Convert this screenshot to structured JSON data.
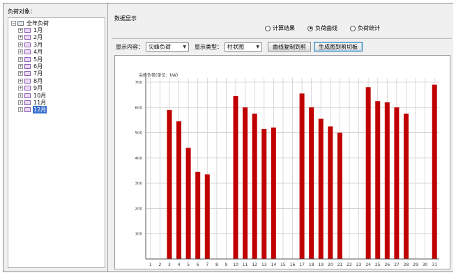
{
  "left_panel": {
    "title": "负荷对象：",
    "tree_root": "全年负荷",
    "tree_items": [
      {
        "label": "1月"
      },
      {
        "label": "2月"
      },
      {
        "label": "3月"
      },
      {
        "label": "4月"
      },
      {
        "label": "5月"
      },
      {
        "label": "6月"
      },
      {
        "label": "7月"
      },
      {
        "label": "8月"
      },
      {
        "label": "9月"
      },
      {
        "label": "10月"
      },
      {
        "label": "11月"
      },
      {
        "label": "12月",
        "selected": true
      }
    ]
  },
  "right_panel": {
    "title": "数据显示",
    "radios": [
      {
        "label": "计算结果",
        "checked": false
      },
      {
        "label": "负荷曲线",
        "checked": true
      },
      {
        "label": "负荷统计",
        "checked": false
      }
    ],
    "toolbar": {
      "content_label": "显示内容：",
      "content_value": "尖峰负荷",
      "type_label": "显示类型：",
      "type_value": "柱状图",
      "copy_button": "曲线复制到剪",
      "gen_button": "生成图到剪切板"
    }
  },
  "colors": {
    "bar": "#c00000",
    "selected": "#3b6fcf"
  },
  "chart_data": {
    "type": "bar",
    "ylabel": "尖峰负荷(单位：kW)",
    "ylim": [
      0,
      700
    ],
    "yticks": [
      100,
      200,
      300,
      400,
      500,
      600,
      700
    ],
    "categories": [
      "1",
      "2",
      "3",
      "4",
      "5",
      "6",
      "7",
      "8",
      "9",
      "10",
      "11",
      "12",
      "13",
      "14",
      "15",
      "16",
      "17",
      "18",
      "19",
      "20",
      "21",
      "22",
      "23",
      "24",
      "25",
      "26",
      "27",
      "28",
      "29",
      "30",
      "31"
    ],
    "values": [
      0,
      0,
      590,
      545,
      440,
      345,
      335,
      0,
      0,
      645,
      600,
      575,
      515,
      520,
      0,
      0,
      655,
      600,
      555,
      525,
      500,
      0,
      0,
      680,
      625,
      620,
      600,
      575,
      0,
      0,
      690
    ],
    "grid": true
  }
}
